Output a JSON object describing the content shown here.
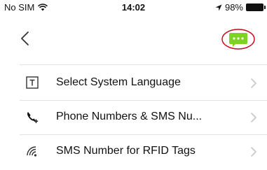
{
  "status": {
    "carrier": "No SIM",
    "time": "14:02",
    "battery": "98%",
    "icons": [
      "wifi-icon",
      "location-arrow-icon",
      "battery-icon"
    ]
  },
  "nav": {
    "back_icon": "chevron-left-icon",
    "message_icon": "chat-bubble-icon",
    "accent": "#7ed321",
    "highlight": "#d0021b"
  },
  "settings": {
    "items": [
      {
        "label": "Select System Language",
        "icon": "text-box-icon"
      },
      {
        "label": "Phone Numbers & SMS Nu...",
        "icon": "phone-add-icon"
      },
      {
        "label": "SMS Number for RFID Tags",
        "icon": "rfid-signal-icon"
      }
    ],
    "chevron_color": "#c7c7cc"
  }
}
